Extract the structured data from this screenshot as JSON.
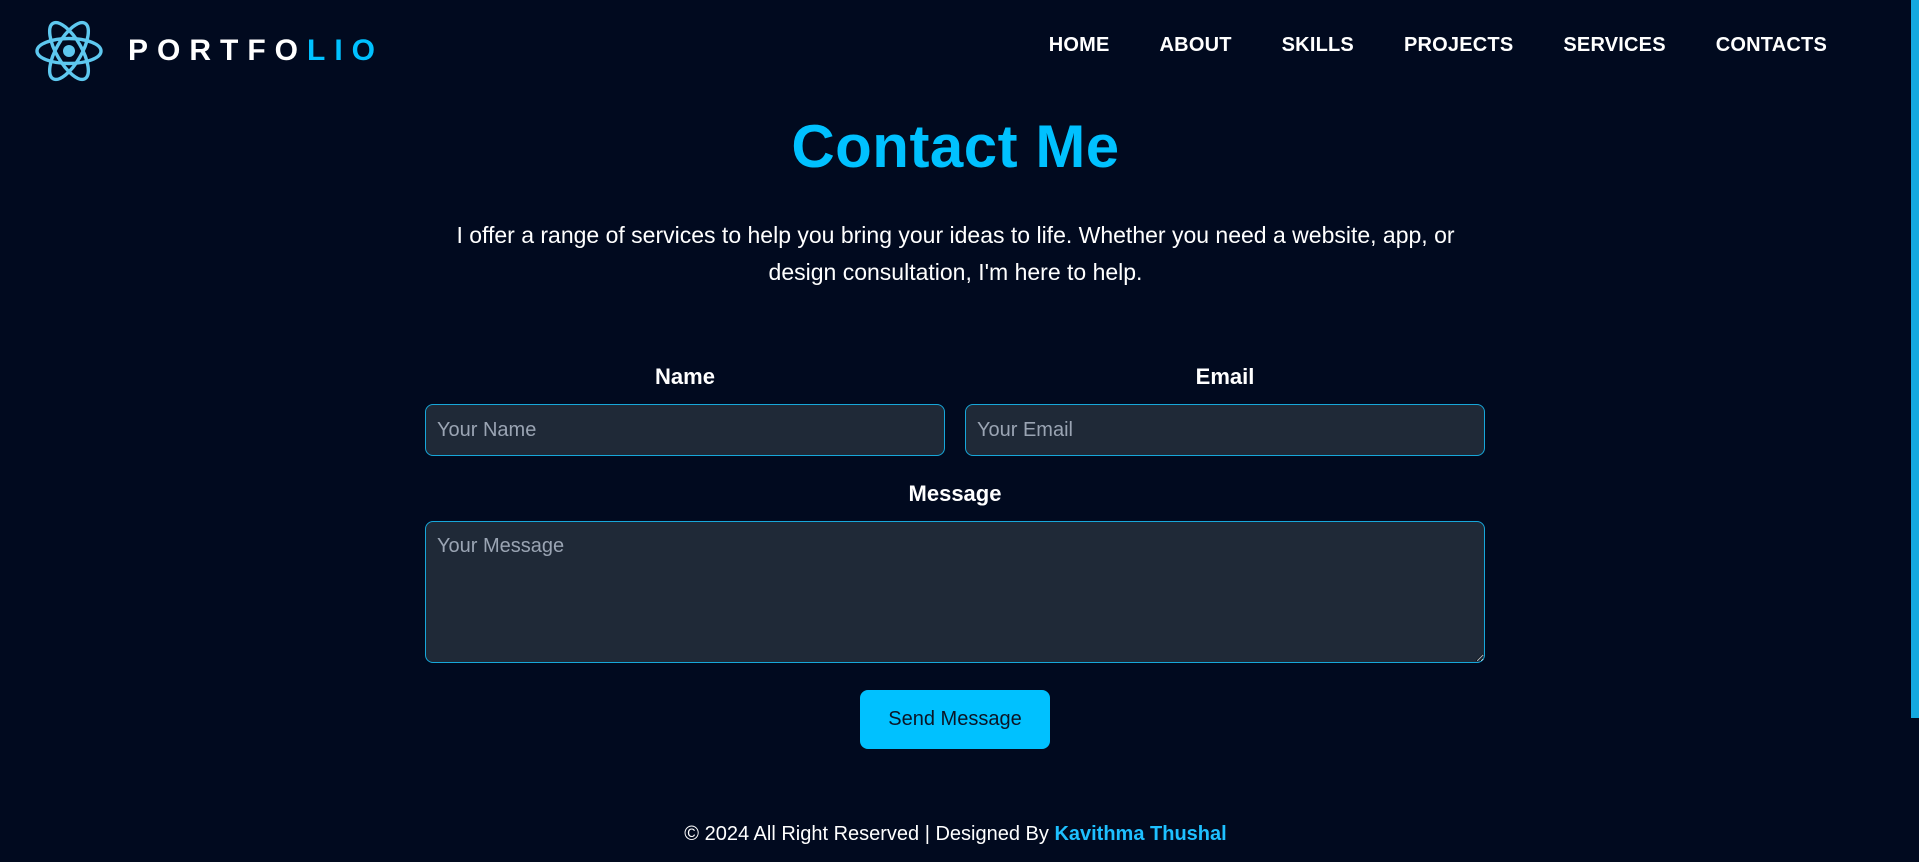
{
  "brand": {
    "text_part1": "PORTFO",
    "text_part2": "LIO",
    "icon": "atom-icon",
    "accent_color": "#00c1ff"
  },
  "nav": {
    "items": [
      {
        "label": "HOME"
      },
      {
        "label": "ABOUT"
      },
      {
        "label": "SKILLS"
      },
      {
        "label": "PROJECTS"
      },
      {
        "label": "SERVICES"
      },
      {
        "label": "CONTACTS"
      }
    ]
  },
  "contact": {
    "title": "Contact Me",
    "intro": "I offer a range of services to help you bring your ideas to life. Whether you need a website, app, or design consultation, I'm here to help.",
    "name_label": "Name",
    "name_placeholder": "Your Name",
    "name_value": "",
    "email_label": "Email",
    "email_placeholder": "Your Email",
    "email_value": "",
    "message_label": "Message",
    "message_placeholder": "Your Message",
    "message_value": "",
    "send_label": "Send Message"
  },
  "footer": {
    "copyright": "© 2024 All Right Reserved | Designed By",
    "author": "Kavithma Thushal"
  },
  "colors": {
    "background": "#010a1f",
    "accent": "#00c1ff",
    "field_bg": "#1f2937",
    "field_border": "#17a7d9"
  }
}
